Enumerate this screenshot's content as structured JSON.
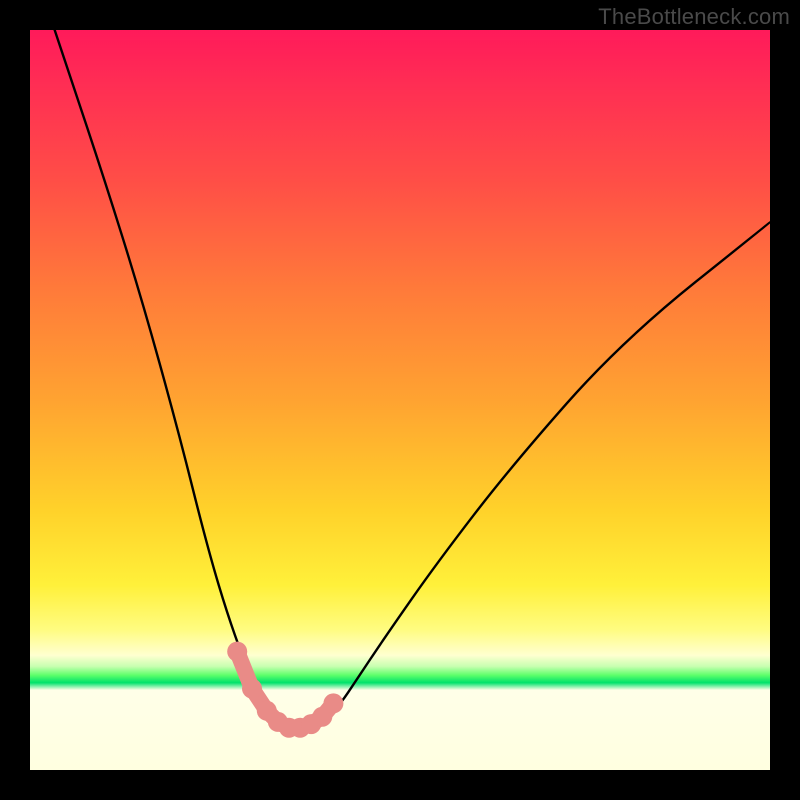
{
  "watermark": "TheBottleneck.com",
  "chart_data": {
    "type": "line",
    "title": "",
    "xlabel": "",
    "ylabel": "",
    "xlim": [
      0,
      100
    ],
    "ylim": [
      0,
      100
    ],
    "grid": false,
    "legend": false,
    "series": [
      {
        "name": "bottleneck-curve",
        "x": [
          0,
          5,
          10,
          15,
          20,
          24,
          27,
          30,
          32,
          34,
          35,
          36,
          38,
          40,
          42,
          44,
          48,
          55,
          65,
          80,
          100
        ],
        "y": [
          110,
          95,
          80,
          64,
          46,
          30,
          20,
          12,
          8,
          6,
          5.5,
          5.5,
          6,
          7,
          9,
          12,
          18,
          28,
          41,
          58,
          74
        ],
        "color": "#000000"
      },
      {
        "name": "highlight-points",
        "type": "scatter",
        "x": [
          28,
          30,
          32,
          33.5,
          35,
          36.5,
          38,
          39.5,
          41
        ],
        "y": [
          16,
          11,
          8,
          6.5,
          5.7,
          5.7,
          6.2,
          7.2,
          9
        ],
        "color": "#e98b87"
      }
    ],
    "background_gradient": {
      "top": "#ff1a5a",
      "mid_upper": "#ff8a36",
      "mid": "#ffe03a",
      "band": "#00e26b",
      "bottom": "#ffffe0"
    }
  }
}
